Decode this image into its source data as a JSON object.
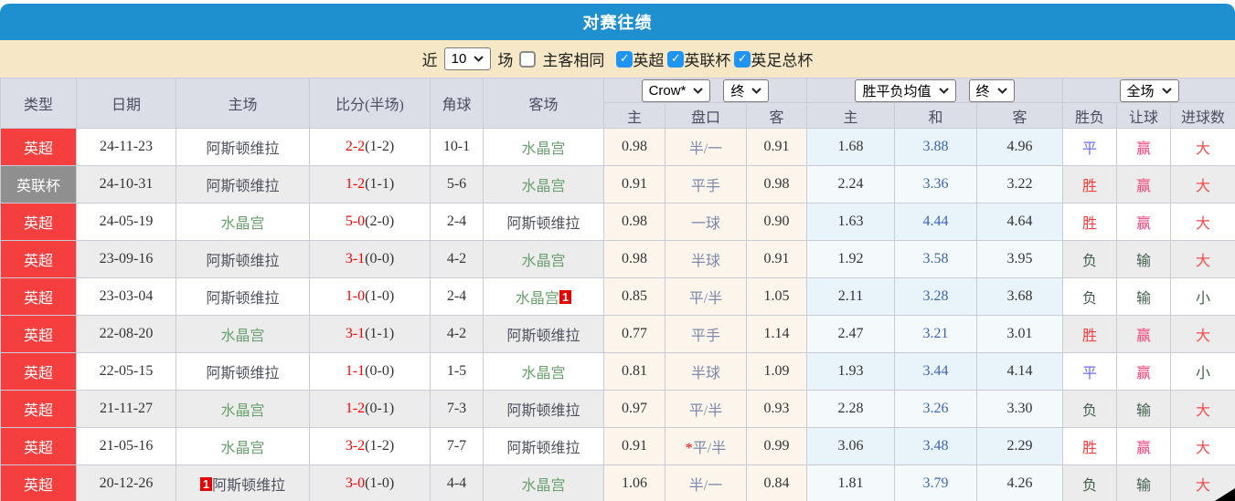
{
  "title": "对赛往绩",
  "colors": {
    "titlebar_blue": "#1f90cf",
    "filterbar_cream": "#f6e8c6",
    "checkbox_blue": "#2094f3",
    "epl_red": "#f53e3e",
    "cup_gray": "#8f8f8f",
    "villa_text": "#50515f",
    "palace_green": "#69a06d",
    "score_red": "#fe0000",
    "handicap_slate": "#7f88aa",
    "avg_draw_blue": "#3c66b0",
    "win_red": "#f53d3d",
    "draw_blue": "#6d6df7",
    "lose_green": "#44604e",
    "let_win_pink": "#f2467b",
    "odds_bg": "#fbf5ec",
    "avg_bg": "#e9f3fa"
  },
  "filters": {
    "near_label": "近",
    "count_select": "10",
    "matches_label": "场",
    "same_venue": {
      "label": "主客相同",
      "checked": false
    },
    "leagues": [
      {
        "label": "英超",
        "checked": true
      },
      {
        "label": "英联杯",
        "checked": true
      },
      {
        "label": "英足总杯",
        "checked": true
      }
    ]
  },
  "controls": {
    "bookmaker_select": "Crow*",
    "bookmaker_period_select": "终",
    "avg_select": "胜平负均值",
    "avg_period_select": "终",
    "scope_select": "全场"
  },
  "table": {
    "columns": [
      "类型",
      "日期",
      "主场",
      "比分(半场)",
      "角球",
      "客场"
    ],
    "sub_columns": [
      "主",
      "盘口",
      "客",
      "主",
      "和",
      "客",
      "胜负",
      "让球",
      "进球数"
    ],
    "rows": [
      {
        "league": "英超",
        "league_type": "epl",
        "date": "24-11-23",
        "home": {
          "name": "阿斯顿维拉",
          "team": "villa"
        },
        "score": "2-2",
        "half": "(1-2)",
        "corner": "10-1",
        "away": {
          "name": "水晶宫",
          "team": "palace"
        },
        "crow": {
          "home": "0.98",
          "handicap": "半/一",
          "star": false,
          "away": "0.91"
        },
        "avg": {
          "home": "1.68",
          "draw": "3.88",
          "away": "4.96"
        },
        "result": {
          "text": "平",
          "type": "draw"
        },
        "let": {
          "text": "赢",
          "type": "win"
        },
        "goals": {
          "text": "大",
          "type": "big"
        }
      },
      {
        "league": "英联杯",
        "league_type": "cup",
        "date": "24-10-31",
        "home": {
          "name": "阿斯顿维拉",
          "team": "villa"
        },
        "score": "1-2",
        "half": "(1-1)",
        "corner": "5-6",
        "away": {
          "name": "水晶宫",
          "team": "palace"
        },
        "crow": {
          "home": "0.91",
          "handicap": "平手",
          "star": false,
          "away": "0.98"
        },
        "avg": {
          "home": "2.24",
          "draw": "3.36",
          "away": "3.22"
        },
        "result": {
          "text": "胜",
          "type": "win"
        },
        "let": {
          "text": "赢",
          "type": "win"
        },
        "goals": {
          "text": "大",
          "type": "big"
        }
      },
      {
        "league": "英超",
        "league_type": "epl",
        "date": "24-05-19",
        "home": {
          "name": "水晶宫",
          "team": "palace"
        },
        "score": "5-0",
        "half": "(2-0)",
        "corner": "2-4",
        "away": {
          "name": "阿斯顿维拉",
          "team": "villa"
        },
        "crow": {
          "home": "0.98",
          "handicap": "一球",
          "star": false,
          "away": "0.90"
        },
        "avg": {
          "home": "1.63",
          "draw": "4.44",
          "away": "4.64"
        },
        "result": {
          "text": "胜",
          "type": "win"
        },
        "let": {
          "text": "赢",
          "type": "win"
        },
        "goals": {
          "text": "大",
          "type": "big"
        }
      },
      {
        "league": "英超",
        "league_type": "epl",
        "date": "23-09-16",
        "home": {
          "name": "阿斯顿维拉",
          "team": "villa"
        },
        "score": "3-1",
        "half": "(0-0)",
        "corner": "4-2",
        "away": {
          "name": "水晶宫",
          "team": "palace"
        },
        "crow": {
          "home": "0.98",
          "handicap": "半球",
          "star": false,
          "away": "0.91"
        },
        "avg": {
          "home": "1.92",
          "draw": "3.58",
          "away": "3.95"
        },
        "result": {
          "text": "负",
          "type": "lose"
        },
        "let": {
          "text": "输",
          "type": "lose"
        },
        "goals": {
          "text": "大",
          "type": "big"
        }
      },
      {
        "league": "英超",
        "league_type": "epl",
        "date": "23-03-04",
        "home": {
          "name": "阿斯顿维拉",
          "team": "villa"
        },
        "score": "1-0",
        "half": "(1-0)",
        "corner": "2-4",
        "away": {
          "name": "水晶宫",
          "team": "palace",
          "badge": "1",
          "badge_pos": "after"
        },
        "crow": {
          "home": "0.85",
          "handicap": "平/半",
          "star": false,
          "away": "1.05"
        },
        "avg": {
          "home": "2.11",
          "draw": "3.28",
          "away": "3.68"
        },
        "result": {
          "text": "负",
          "type": "lose"
        },
        "let": {
          "text": "输",
          "type": "lose"
        },
        "goals": {
          "text": "小",
          "type": "small"
        }
      },
      {
        "league": "英超",
        "league_type": "epl",
        "date": "22-08-20",
        "home": {
          "name": "水晶宫",
          "team": "palace"
        },
        "score": "3-1",
        "half": "(1-1)",
        "corner": "4-2",
        "away": {
          "name": "阿斯顿维拉",
          "team": "villa"
        },
        "crow": {
          "home": "0.77",
          "handicap": "平手",
          "star": false,
          "away": "1.14"
        },
        "avg": {
          "home": "2.47",
          "draw": "3.21",
          "away": "3.01"
        },
        "result": {
          "text": "胜",
          "type": "win"
        },
        "let": {
          "text": "赢",
          "type": "win"
        },
        "goals": {
          "text": "大",
          "type": "big"
        }
      },
      {
        "league": "英超",
        "league_type": "epl",
        "date": "22-05-15",
        "home": {
          "name": "阿斯顿维拉",
          "team": "villa"
        },
        "score": "1-1",
        "half": "(0-0)",
        "corner": "1-5",
        "away": {
          "name": "水晶宫",
          "team": "palace"
        },
        "crow": {
          "home": "0.81",
          "handicap": "半球",
          "star": false,
          "away": "1.09"
        },
        "avg": {
          "home": "1.93",
          "draw": "3.44",
          "away": "4.14"
        },
        "result": {
          "text": "平",
          "type": "draw"
        },
        "let": {
          "text": "赢",
          "type": "win"
        },
        "goals": {
          "text": "小",
          "type": "small"
        }
      },
      {
        "league": "英超",
        "league_type": "epl",
        "date": "21-11-27",
        "home": {
          "name": "水晶宫",
          "team": "palace"
        },
        "score": "1-2",
        "half": "(0-1)",
        "corner": "7-3",
        "away": {
          "name": "阿斯顿维拉",
          "team": "villa"
        },
        "crow": {
          "home": "0.97",
          "handicap": "平/半",
          "star": false,
          "away": "0.93"
        },
        "avg": {
          "home": "2.28",
          "draw": "3.26",
          "away": "3.30"
        },
        "result": {
          "text": "负",
          "type": "lose"
        },
        "let": {
          "text": "输",
          "type": "lose"
        },
        "goals": {
          "text": "大",
          "type": "big"
        }
      },
      {
        "league": "英超",
        "league_type": "epl",
        "date": "21-05-16",
        "home": {
          "name": "水晶宫",
          "team": "palace"
        },
        "score": "3-2",
        "half": "(1-2)",
        "corner": "7-7",
        "away": {
          "name": "阿斯顿维拉",
          "team": "villa"
        },
        "crow": {
          "home": "0.91",
          "handicap": "平/半",
          "star": true,
          "away": "0.99"
        },
        "avg": {
          "home": "3.06",
          "draw": "3.48",
          "away": "2.29"
        },
        "result": {
          "text": "胜",
          "type": "win"
        },
        "let": {
          "text": "赢",
          "type": "win"
        },
        "goals": {
          "text": "大",
          "type": "big"
        }
      },
      {
        "league": "英超",
        "league_type": "epl",
        "date": "20-12-26",
        "home": {
          "name": "阿斯顿维拉",
          "team": "villa",
          "badge": "1",
          "badge_pos": "before"
        },
        "score": "3-0",
        "half": "(1-0)",
        "corner": "4-4",
        "away": {
          "name": "水晶宫",
          "team": "palace"
        },
        "crow": {
          "home": "1.06",
          "handicap": "半/一",
          "star": false,
          "away": "0.84"
        },
        "avg": {
          "home": "1.81",
          "draw": "3.79",
          "away": "4.26"
        },
        "result": {
          "text": "负",
          "type": "lose"
        },
        "let": {
          "text": "输",
          "type": "lose"
        },
        "goals": {
          "text": "大",
          "type": "big"
        }
      }
    ]
  }
}
